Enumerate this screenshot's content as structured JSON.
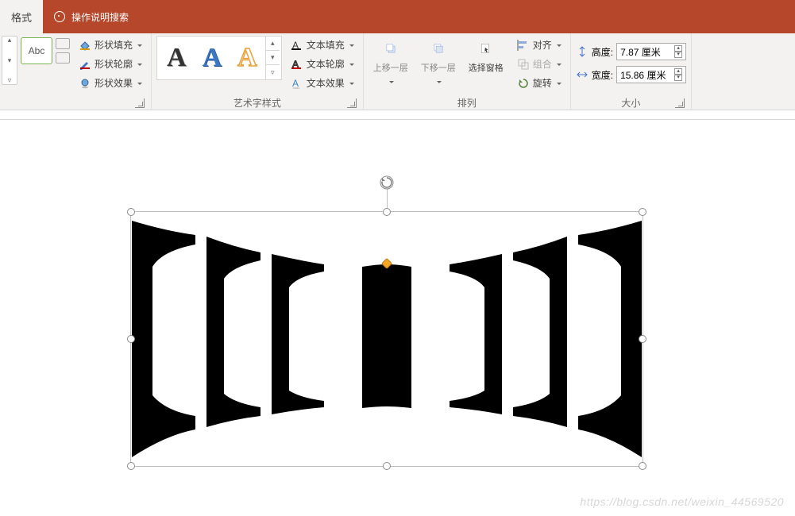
{
  "topbar": {
    "active_tab": "格式",
    "tell_me": "操作说明搜索"
  },
  "ribbon": {
    "shape_styles": {
      "abc_sample": "Abc",
      "fill": "形状填充",
      "outline": "形状轮廓",
      "effects": "形状效果"
    },
    "wordart": {
      "group_label": "艺术字样式",
      "text_fill": "文本填充",
      "text_outline": "文本轮廓",
      "text_effects": "文本效果"
    },
    "arrange": {
      "group_label": "排列",
      "bring_forward": "上移一层",
      "send_backward": "下移一层",
      "selection_pane": "选择窗格",
      "align": "对齐",
      "group": "组合",
      "rotate": "旋转"
    },
    "size": {
      "group_label": "大小",
      "height_label": "高度:",
      "height_value": "7.87 厘米",
      "width_label": "宽度:",
      "width_value": "15.86 厘米"
    }
  },
  "watermark": "https://blog.csdn.net/weixin_44569520"
}
